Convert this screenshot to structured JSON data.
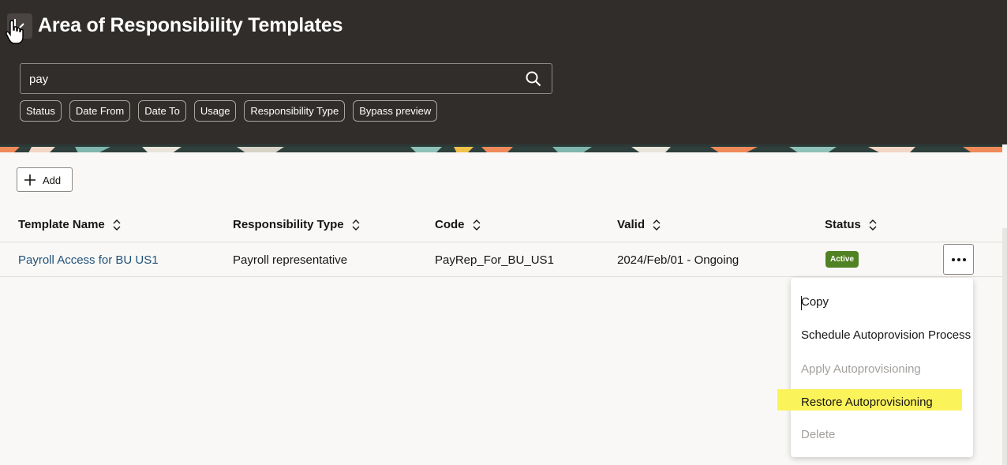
{
  "header": {
    "title": "Area of Responsibility Templates",
    "back_icon": "back-arrow-icon"
  },
  "search": {
    "value": "pay",
    "icon": "search-icon"
  },
  "filters": [
    "Status",
    "Date From",
    "Date To",
    "Usage",
    "Responsibility Type",
    "Bypass preview"
  ],
  "toolbar": {
    "add_label": "Add"
  },
  "table": {
    "columns": [
      "Template Name",
      "Responsibility Type",
      "Code",
      "Valid",
      "Status"
    ],
    "rows": [
      {
        "template_name": "Payroll Access for BU US1",
        "responsibility_type": "Payroll representative",
        "code": "PayRep_For_BU_US1",
        "valid": "2024/Feb/01 - Ongoing",
        "status": "Active"
      }
    ]
  },
  "menu": {
    "items": [
      {
        "label": "Copy",
        "enabled": true
      },
      {
        "label": "Schedule Autoprovision Process",
        "enabled": true
      },
      {
        "label": "Apply Autoprovisioning",
        "enabled": false
      },
      {
        "label": "Restore Autoprovisioning",
        "enabled": true,
        "highlighted": true
      },
      {
        "label": "Delete",
        "enabled": false
      }
    ]
  },
  "colors": {
    "header_bg": "#312d2a",
    "status_active": "#508223",
    "link": "#21527a",
    "highlight": "#fbf35a"
  }
}
